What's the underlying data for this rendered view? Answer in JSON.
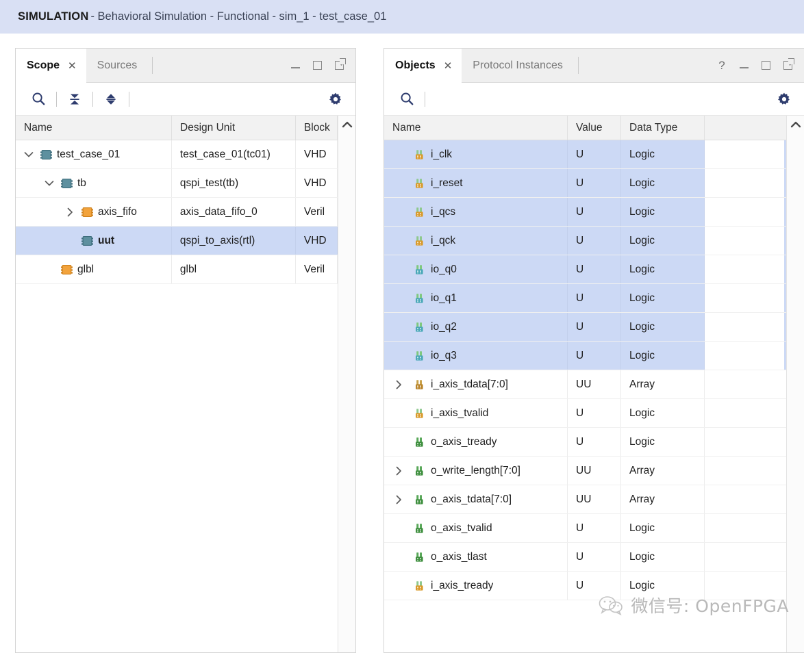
{
  "banner": {
    "app_label": "SIMULATION",
    "breadcrumb": " - Behavioral Simulation - Functional - sim_1 - test_case_01"
  },
  "scope_panel": {
    "tabs": [
      {
        "label": "Scope",
        "active": true,
        "closable": true
      },
      {
        "label": "Sources",
        "active": false,
        "closable": false
      }
    ],
    "window_controls": [
      "minimize",
      "maximize",
      "float"
    ],
    "toolbar": [
      {
        "name": "search-icon",
        "label": "Search"
      },
      {
        "name": "collapse-all-icon",
        "label": "Collapse All"
      },
      {
        "name": "expand-all-icon",
        "label": "Expand All"
      },
      {
        "name": "settings-gear-icon",
        "label": "Settings"
      }
    ],
    "columns": [
      "Name",
      "Design Unit",
      "Block"
    ],
    "rows": [
      {
        "name": "test_case_01",
        "design_unit": "test_case_01(tc01)",
        "block": "VHD",
        "depth": 0,
        "chevron": "down",
        "icon": "module-vhdl-icon",
        "selected": false,
        "bold": false
      },
      {
        "name": "tb",
        "design_unit": "qspi_test(tb)",
        "block": "VHD",
        "depth": 1,
        "chevron": "down",
        "icon": "module-vhdl-icon",
        "selected": false,
        "bold": false
      },
      {
        "name": "axis_fifo",
        "design_unit": "axis_data_fifo_0",
        "block": "Veril",
        "depth": 2,
        "chevron": "right",
        "icon": "module-verilog-icon",
        "selected": false,
        "bold": false
      },
      {
        "name": "uut",
        "design_unit": "qspi_to_axis(rtl)",
        "block": "VHD",
        "depth": 2,
        "chevron": "none",
        "icon": "module-vhdl-icon",
        "selected": true,
        "bold": true
      },
      {
        "name": "glbl",
        "design_unit": "glbl",
        "block": "Veril",
        "depth": 1,
        "chevron": "none",
        "icon": "module-verilog-icon",
        "selected": false,
        "bold": false
      }
    ]
  },
  "objects_panel": {
    "tabs": [
      {
        "label": "Objects",
        "active": true,
        "closable": true
      },
      {
        "label": "Protocol Instances",
        "active": false,
        "closable": false
      }
    ],
    "window_controls": [
      "help",
      "minimize",
      "maximize",
      "float"
    ],
    "toolbar": [
      {
        "name": "search-icon",
        "label": "Search"
      },
      {
        "name": "settings-gear-icon",
        "label": "Settings"
      }
    ],
    "columns": [
      "Name",
      "Value",
      "Data Type"
    ],
    "rows": [
      {
        "name": "i_clk",
        "value": "U",
        "data_type": "Logic",
        "icon": "signal-input-icon",
        "chevron": "none",
        "selected": true
      },
      {
        "name": "i_reset",
        "value": "U",
        "data_type": "Logic",
        "icon": "signal-input-icon",
        "chevron": "none",
        "selected": true
      },
      {
        "name": "i_qcs",
        "value": "U",
        "data_type": "Logic",
        "icon": "signal-input-icon",
        "chevron": "none",
        "selected": true
      },
      {
        "name": "i_qck",
        "value": "U",
        "data_type": "Logic",
        "icon": "signal-input-icon",
        "chevron": "none",
        "selected": true
      },
      {
        "name": "io_q0",
        "value": "U",
        "data_type": "Logic",
        "icon": "signal-inout-icon",
        "chevron": "none",
        "selected": true
      },
      {
        "name": "io_q1",
        "value": "U",
        "data_type": "Logic",
        "icon": "signal-inout-icon",
        "chevron": "none",
        "selected": true
      },
      {
        "name": "io_q2",
        "value": "U",
        "data_type": "Logic",
        "icon": "signal-inout-icon",
        "chevron": "none",
        "selected": true
      },
      {
        "name": "io_q3",
        "value": "U",
        "data_type": "Logic",
        "icon": "signal-inout-icon",
        "chevron": "none",
        "selected": true
      },
      {
        "name": "i_axis_tdata[7:0]",
        "value": "UU",
        "data_type": "Array",
        "icon": "signal-input-array-icon",
        "chevron": "right",
        "selected": false
      },
      {
        "name": "i_axis_tvalid",
        "value": "U",
        "data_type": "Logic",
        "icon": "signal-input-icon",
        "chevron": "none",
        "selected": false
      },
      {
        "name": "o_axis_tready",
        "value": "U",
        "data_type": "Logic",
        "icon": "signal-output-icon",
        "chevron": "none",
        "selected": false
      },
      {
        "name": "o_write_length[7:0]",
        "value": "UU",
        "data_type": "Array",
        "icon": "signal-output-array-icon",
        "chevron": "right",
        "selected": false
      },
      {
        "name": "o_axis_tdata[7:0]",
        "value": "UU",
        "data_type": "Array",
        "icon": "signal-output-array-icon",
        "chevron": "right",
        "selected": false
      },
      {
        "name": "o_axis_tvalid",
        "value": "U",
        "data_type": "Logic",
        "icon": "signal-output-icon",
        "chevron": "none",
        "selected": false
      },
      {
        "name": "o_axis_tlast",
        "value": "U",
        "data_type": "Logic",
        "icon": "signal-output-icon",
        "chevron": "none",
        "selected": false
      },
      {
        "name": "i_axis_tready",
        "value": "U",
        "data_type": "Logic",
        "icon": "signal-input-icon",
        "chevron": "none",
        "selected": false
      }
    ]
  },
  "watermark": {
    "icon": "wechat-icon",
    "text": "微信号: OpenFPGA"
  },
  "colors": {
    "banner_bg": "#d9e0f4",
    "selection_bg": "#ccd9f5",
    "tab_inactive_bg": "#efefef",
    "accent_icon": "#2e3c6e",
    "module_vhdl": "#5b8f9e",
    "module_verilog": "#f2a33c",
    "signal_input": "#d99a2b",
    "signal_output": "#4a9e4a"
  }
}
